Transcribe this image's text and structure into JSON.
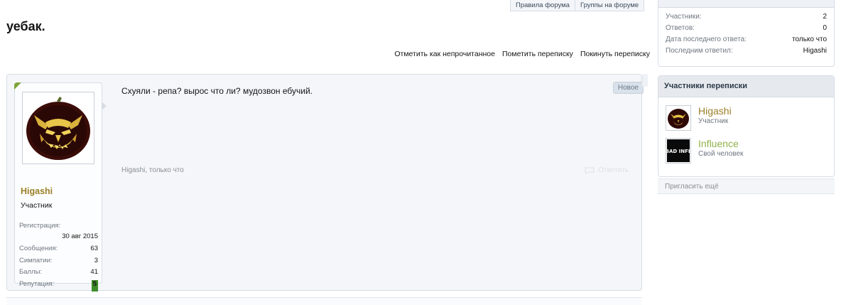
{
  "nav": {
    "tabs": [
      "Правила форума",
      "Группы на форуме"
    ]
  },
  "thread": {
    "title": "уебак."
  },
  "actions": {
    "mark_unread": "Отметить как непрочитанное",
    "mark_conversation": "Пометить переписку",
    "leave": "Покинуть переписку"
  },
  "message": {
    "author": "Higashi",
    "author_title": "Участник",
    "stats": {
      "registration_label": "Регистрация:",
      "registration_value": "30 авг 2015",
      "messages_label": "Сообщения:",
      "messages_value": "63",
      "likes_label": "Симпатии:",
      "likes_value": "3",
      "points_label": "Баллы:",
      "points_value": "41",
      "reputation_label": "Репутация:",
      "reputation_value": "5"
    },
    "text": "Схуяли - репа? вырос что ли? мудозвон ебучий.",
    "badge": "Новое",
    "meta_author": "Higashi",
    "meta_time": ", только что",
    "reply_label": "Ответить"
  },
  "conversation_info": {
    "rows": [
      {
        "label": "Участники:",
        "value": "2"
      },
      {
        "label": "Ответов:",
        "value": "0"
      },
      {
        "label": "Дата последнего ответа:",
        "value": "только что"
      },
      {
        "label": "Последним ответил:",
        "value": "Higashi"
      }
    ]
  },
  "participants": {
    "title": "Участники переписки",
    "items": [
      {
        "name": "Higashi",
        "role": "Участник"
      },
      {
        "name": "Influence",
        "role": "Свой человек",
        "avatar_text": "BAD INFL"
      }
    ],
    "invite": "Пригласить ещё"
  },
  "colors": {
    "username_gold": "#9b7f25",
    "username_green": "#8fb14a",
    "reputation_bg": "#3d8c2a",
    "online_marker": "#7da43a"
  }
}
